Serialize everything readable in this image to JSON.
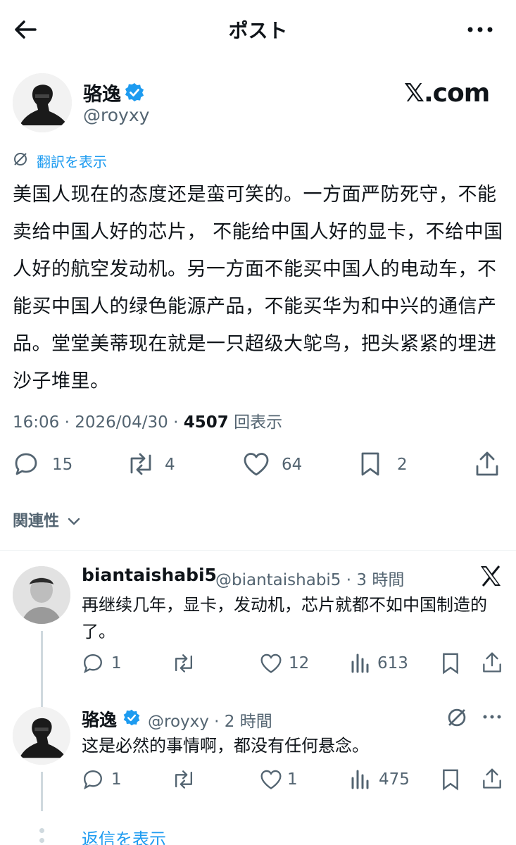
{
  "header": {
    "title": "ポスト"
  },
  "post": {
    "author_name": "骆逸",
    "author_handle": "@royxy",
    "watermark": "𝕏.com",
    "translate_label": "翻訳を表示",
    "text": "美国人现在的态度还是蛮可笑的。一方面严防死守，不能卖给中国人好的芯片， 不能给中国人好的显卡，不给中国人好的航空发动机。另一方面不能买中国人的电动车，不能买中国人的绿色能源产品，不能买华为和中兴的通信产品。堂堂美蒂现在就是一只超级大鸵鸟，把头紧紧的埋进沙子堆里。",
    "time": "16:06",
    "date": "2026/04/30",
    "views": "4507",
    "views_label": "回表示",
    "replies": "15",
    "reposts": "4",
    "likes": "64",
    "bookmarks": "2"
  },
  "related_label": "関連性",
  "replies": [
    {
      "name": "biantaishabi5",
      "handle": "@biantaishabi5",
      "time": "3 時間",
      "text": "再继续几年，显卡，发动机，芯片就都不如中国制造的了。",
      "replies": "1",
      "reposts": "",
      "likes": "12",
      "views": "613"
    },
    {
      "name": "骆逸",
      "handle": "@royxy",
      "time": "2 時間",
      "text": "这是必然的事情啊，都没有任何悬念。",
      "replies": "1",
      "reposts": "",
      "likes": "1",
      "views": "475"
    }
  ],
  "show_replies_label": "返信を表示",
  "colors": {
    "accent": "#1d9bf0",
    "muted": "#536471",
    "text": "#0f1419"
  }
}
